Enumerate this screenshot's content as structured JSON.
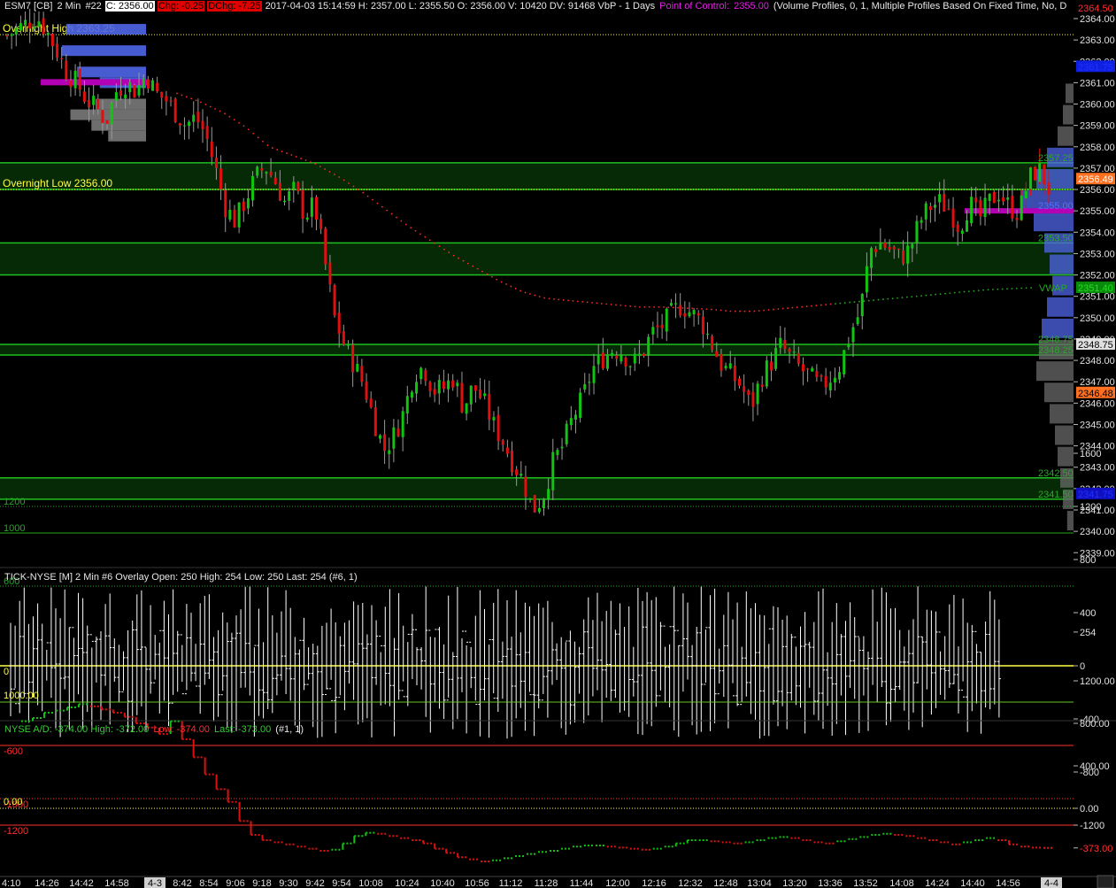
{
  "header": {
    "symbol": "ESM7 [CB]",
    "interval": "2 Min",
    "bar_no": "#22",
    "close": "C: 2356.00",
    "chg": "Chg: -0.25",
    "dchg": "DChg: -7.25",
    "stats": "2017-04-03 15:14:59  H: 2357.00  L: 2355.50  O: 2356.00  V: 10420  DV: 91468  VbP - 1 Days",
    "poc_label": "Point of Control:",
    "poc_value": "2355.00",
    "profile_info": "(Volume Profiles, 0, 1, Multiple Profiles Based On Fixed Time, No, D"
  },
  "main_panel": {
    "overnight_high_label": "Overnight High",
    "overnight_high_value": "2363.25",
    "overnight_low_label": "Overnight Low",
    "overnight_low_value": "2356.00",
    "vwap_label": "VWAP",
    "level_labels": [
      "2357.25",
      "2353.50",
      "2348.75",
      "2348.25",
      "2342.50",
      "2341.50",
      "2355.00"
    ],
    "right_tags": [
      "2364.50",
      "2361.75",
      "2356.49",
      "2351.40",
      "2348.75",
      "2346.48",
      "2341.75"
    ]
  },
  "tick_panel": {
    "title": "TICK-NYSE [M]  2 Min   #6 Overlay  Open: 250  High: 254  Low: 250  Last: 254  (#6, 1)",
    "levels": [
      "1200",
      "1000",
      "600",
      "0",
      "-600",
      "-1000",
      "-1200"
    ],
    "last_tag": "254"
  },
  "ad_panel": {
    "title_prefix": "NYSE A/D: -374.00   High: -372.00",
    "title_low": "Low: -374.00",
    "title_last": "Last: -373.00",
    "title_suffix": "(#1, 1)",
    "left_labels": [
      "1000.00",
      "0.00"
    ],
    "last_tag": "-373.00"
  },
  "colors": {
    "up": "#12c412",
    "down": "#e01010",
    "zone_line": "#1fbf1f",
    "zone_fill": "#062906",
    "yellow": "#ffff40",
    "vwap": "#22aa22",
    "profile": "#5066e8",
    "profile_grey": "#7a7a7a",
    "poc": "#b400b4"
  },
  "chart_data": [
    {
      "type": "candlestick",
      "title": "ESM7 [CB] 2 Min",
      "ylim": [
        2339,
        2364.5
      ],
      "y_ticks": [
        2364,
        2363,
        2362,
        2361,
        2360,
        2359,
        2358,
        2357,
        2356,
        2355,
        2354,
        2353,
        2352,
        2351,
        2350,
        2349,
        2348,
        2347,
        2346,
        2345,
        2344,
        2343,
        2342,
        2341,
        2340,
        2339
      ],
      "x_tick_labels": [
        "4:10",
        "14:26",
        "14:42",
        "14:58",
        "4-3",
        "8:42",
        "8:54",
        "9:06",
        "9:18",
        "9:30",
        "9:42",
        "9:54",
        "10:08",
        "10:24",
        "10:40",
        "10:56",
        "11:12",
        "11:28",
        "11:44",
        "12:00",
        "12:16",
        "12:32",
        "12:48",
        "13:04",
        "13:20",
        "13:36",
        "13:52",
        "14:08",
        "14:24",
        "14:40",
        "14:56",
        "4-4"
      ],
      "price_path": [
        2363.2,
        2363.5,
        2363.8,
        2364.1,
        2363.4,
        2362.5,
        2361.5,
        2361.0,
        2360.2,
        2359.8,
        2359.2,
        2360.6,
        2361.0,
        2360.6,
        2361.4,
        2360.5,
        2360.2,
        2359.6,
        2359.0,
        2359.4,
        2358.6,
        2357.0,
        2355.2,
        2354.5,
        2355.5,
        2356.5,
        2357.1,
        2356.4,
        2355.4,
        2356.0,
        2354.8,
        2355.3,
        2352.7,
        2350.0,
        2348.7,
        2347.8,
        2346.8,
        2345.2,
        2343.8,
        2344.5,
        2345.6,
        2347.4,
        2347.7,
        2346.6,
        2346.7,
        2347.2,
        2345.8,
        2346.8,
        2346.1,
        2345.0,
        2344.2,
        2343.2,
        2342.4,
        2341.0,
        2341.6,
        2343.2,
        2344.0,
        2345.3,
        2346.2,
        2347.6,
        2348.1,
        2348.5,
        2348.4,
        2347.8,
        2348.3,
        2349.3,
        2349.6,
        2350.2,
        2350.6,
        2350.2,
        2349.8,
        2348.8,
        2347.8,
        2347.3,
        2346.8,
        2345.8,
        2347.2,
        2347.9,
        2348.7,
        2348.1,
        2347.6,
        2347.2,
        2346.7,
        2347.2,
        2347.8,
        2349.3,
        2350.3,
        2353.2,
        2353.5,
        2353.2,
        2352.8,
        2353.2,
        2354.5,
        2355.2,
        2355.4,
        2355.1,
        2354.2,
        2355.4,
        2354.6,
        2355.4,
        2355.9,
        2355.2,
        2354.9,
        2356.5,
        2357.0,
        2356.0
      ],
      "vwap_path": [
        2360.5,
        2360.1,
        2359.6,
        2358.9,
        2358.0,
        2357.6,
        2357.2,
        2356.6,
        2355.9,
        2355.1,
        2354.3,
        2353.6,
        2352.9,
        2352.3,
        2351.7,
        2351.2,
        2350.9,
        2350.8,
        2350.7,
        2350.6,
        2350.5,
        2350.5,
        2350.45,
        2350.4,
        2350.3,
        2350.3,
        2350.4,
        2350.5,
        2350.6,
        2350.7,
        2350.8,
        2350.9,
        2351.0,
        2351.1,
        2351.2,
        2351.3,
        2351.35,
        2351.4
      ],
      "horizontal_levels": [
        {
          "label": "Overnight High",
          "value": 2363.25
        },
        {
          "label": "Overnight Low",
          "value": 2356.0
        },
        {
          "label": "VWAP",
          "value": 2351.4
        }
      ],
      "zones": [
        [
          2356.0,
          2357.25
        ],
        [
          2352.0,
          2353.5
        ],
        [
          2348.25,
          2348.75
        ],
        [
          2341.5,
          2342.5
        ]
      ],
      "volume_profile_top": [
        [
          2363.5,
          0.95
        ],
        [
          2362.5,
          1.0
        ],
        [
          2361.5,
          0.82
        ],
        [
          2361.0,
          0.55
        ],
        [
          2360.0,
          0.6
        ],
        [
          2359.5,
          0.9
        ],
        [
          2359.0,
          0.65
        ],
        [
          2358.5,
          0.45
        ]
      ],
      "volume_profile_right": [
        [
          2360.5,
          0.15
        ],
        [
          2359.5,
          0.2
        ],
        [
          2358.5,
          0.3
        ],
        [
          2357.5,
          0.5
        ],
        [
          2356.5,
          0.7
        ],
        [
          2355.5,
          1.0
        ],
        [
          2354.5,
          0.75
        ],
        [
          2353.5,
          0.55
        ],
        [
          2352.5,
          0.45
        ],
        [
          2351.5,
          0.4
        ],
        [
          2350.5,
          0.5
        ],
        [
          2349.5,
          0.6
        ],
        [
          2348.5,
          0.65
        ],
        [
          2347.5,
          0.7
        ],
        [
          2346.5,
          0.55
        ],
        [
          2345.5,
          0.45
        ],
        [
          2344.5,
          0.35
        ],
        [
          2343.5,
          0.3
        ],
        [
          2342.5,
          0.25
        ],
        [
          2341.5,
          0.2
        ],
        [
          2340.5,
          0.12
        ]
      ]
    },
    {
      "type": "bar",
      "title": "TICK-NYSE [M] 2 Min",
      "ylim": [
        -1200,
        1600
      ],
      "y_ticks": [
        1600,
        1200,
        800,
        400,
        254,
        0,
        -400,
        -800,
        -1200
      ],
      "open": 250,
      "high": 254,
      "low": 250,
      "last": 254,
      "reference_levels": [
        1200,
        1000,
        600,
        0,
        -600,
        -1000,
        -1200
      ]
    },
    {
      "type": "line",
      "title": "NYSE A/D",
      "ylim": [
        -1000,
        1300
      ],
      "y_ticks": [
        1200,
        800,
        400,
        0,
        -373,
        -800
      ],
      "open": -374,
      "high": -372,
      "low": -374,
      "last": -373,
      "series": [
        {
          "values": [
            820,
            850,
            900,
            920,
            950,
            980,
            960,
            930,
            900,
            860,
            800,
            760,
            700,
            820,
            650,
            480,
            320,
            180,
            60,
            -120,
            -250,
            -300,
            -320,
            -340,
            -360,
            -380,
            -400,
            -390,
            -330,
            -260,
            -230,
            -240,
            -260,
            -280,
            -300,
            -330,
            -380,
            -420,
            -460,
            -480,
            -500,
            -490,
            -470,
            -450,
            -430,
            -410,
            -400,
            -380,
            -360,
            -350,
            -350,
            -360,
            -370,
            -380,
            -390,
            -380,
            -360,
            -330,
            -300,
            -300,
            -310,
            -320,
            -330,
            -320,
            -300,
            -280,
            -270,
            -280,
            -300,
            -320,
            -330,
            -310,
            -290,
            -270,
            -250,
            -240,
            -250,
            -260,
            -280,
            -300,
            -320,
            -340,
            -320,
            -300,
            -280,
            -300,
            -340,
            -360,
            -370,
            -373
          ]
        }
      ]
    }
  ]
}
